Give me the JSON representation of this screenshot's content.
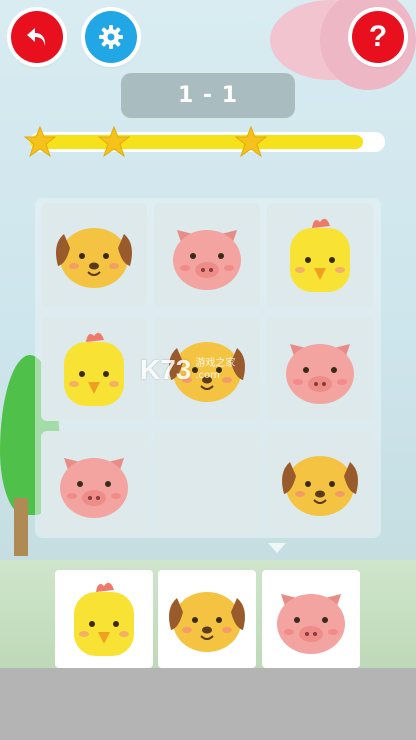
{
  "level": {
    "label": "1 - 1"
  },
  "progress": {
    "fraction": 0.96,
    "stars_earned": 3
  },
  "buttons": {
    "back_icon": "undo-arrow-icon",
    "settings_icon": "gear-icon",
    "help_label": "?"
  },
  "colors": {
    "red_button": "#e8101e",
    "blue_button": "#22a7e6",
    "star": "#f4c21a",
    "progress_fill": "#f6e21a",
    "dog": "#f5c342",
    "dog_ear": "#9a5b2c",
    "pig": "#f3a3a0",
    "chick": "#f8e335"
  },
  "board": {
    "rows": [
      [
        "dog",
        "pig",
        "chick"
      ],
      [
        "chick",
        "dog",
        "pig"
      ],
      [
        "pig",
        "",
        "dog"
      ]
    ]
  },
  "tray": [
    "chick",
    "dog",
    "pig"
  ],
  "watermark": {
    "logo": "K73",
    "line1": "游戏之家",
    "line2": ".com"
  }
}
